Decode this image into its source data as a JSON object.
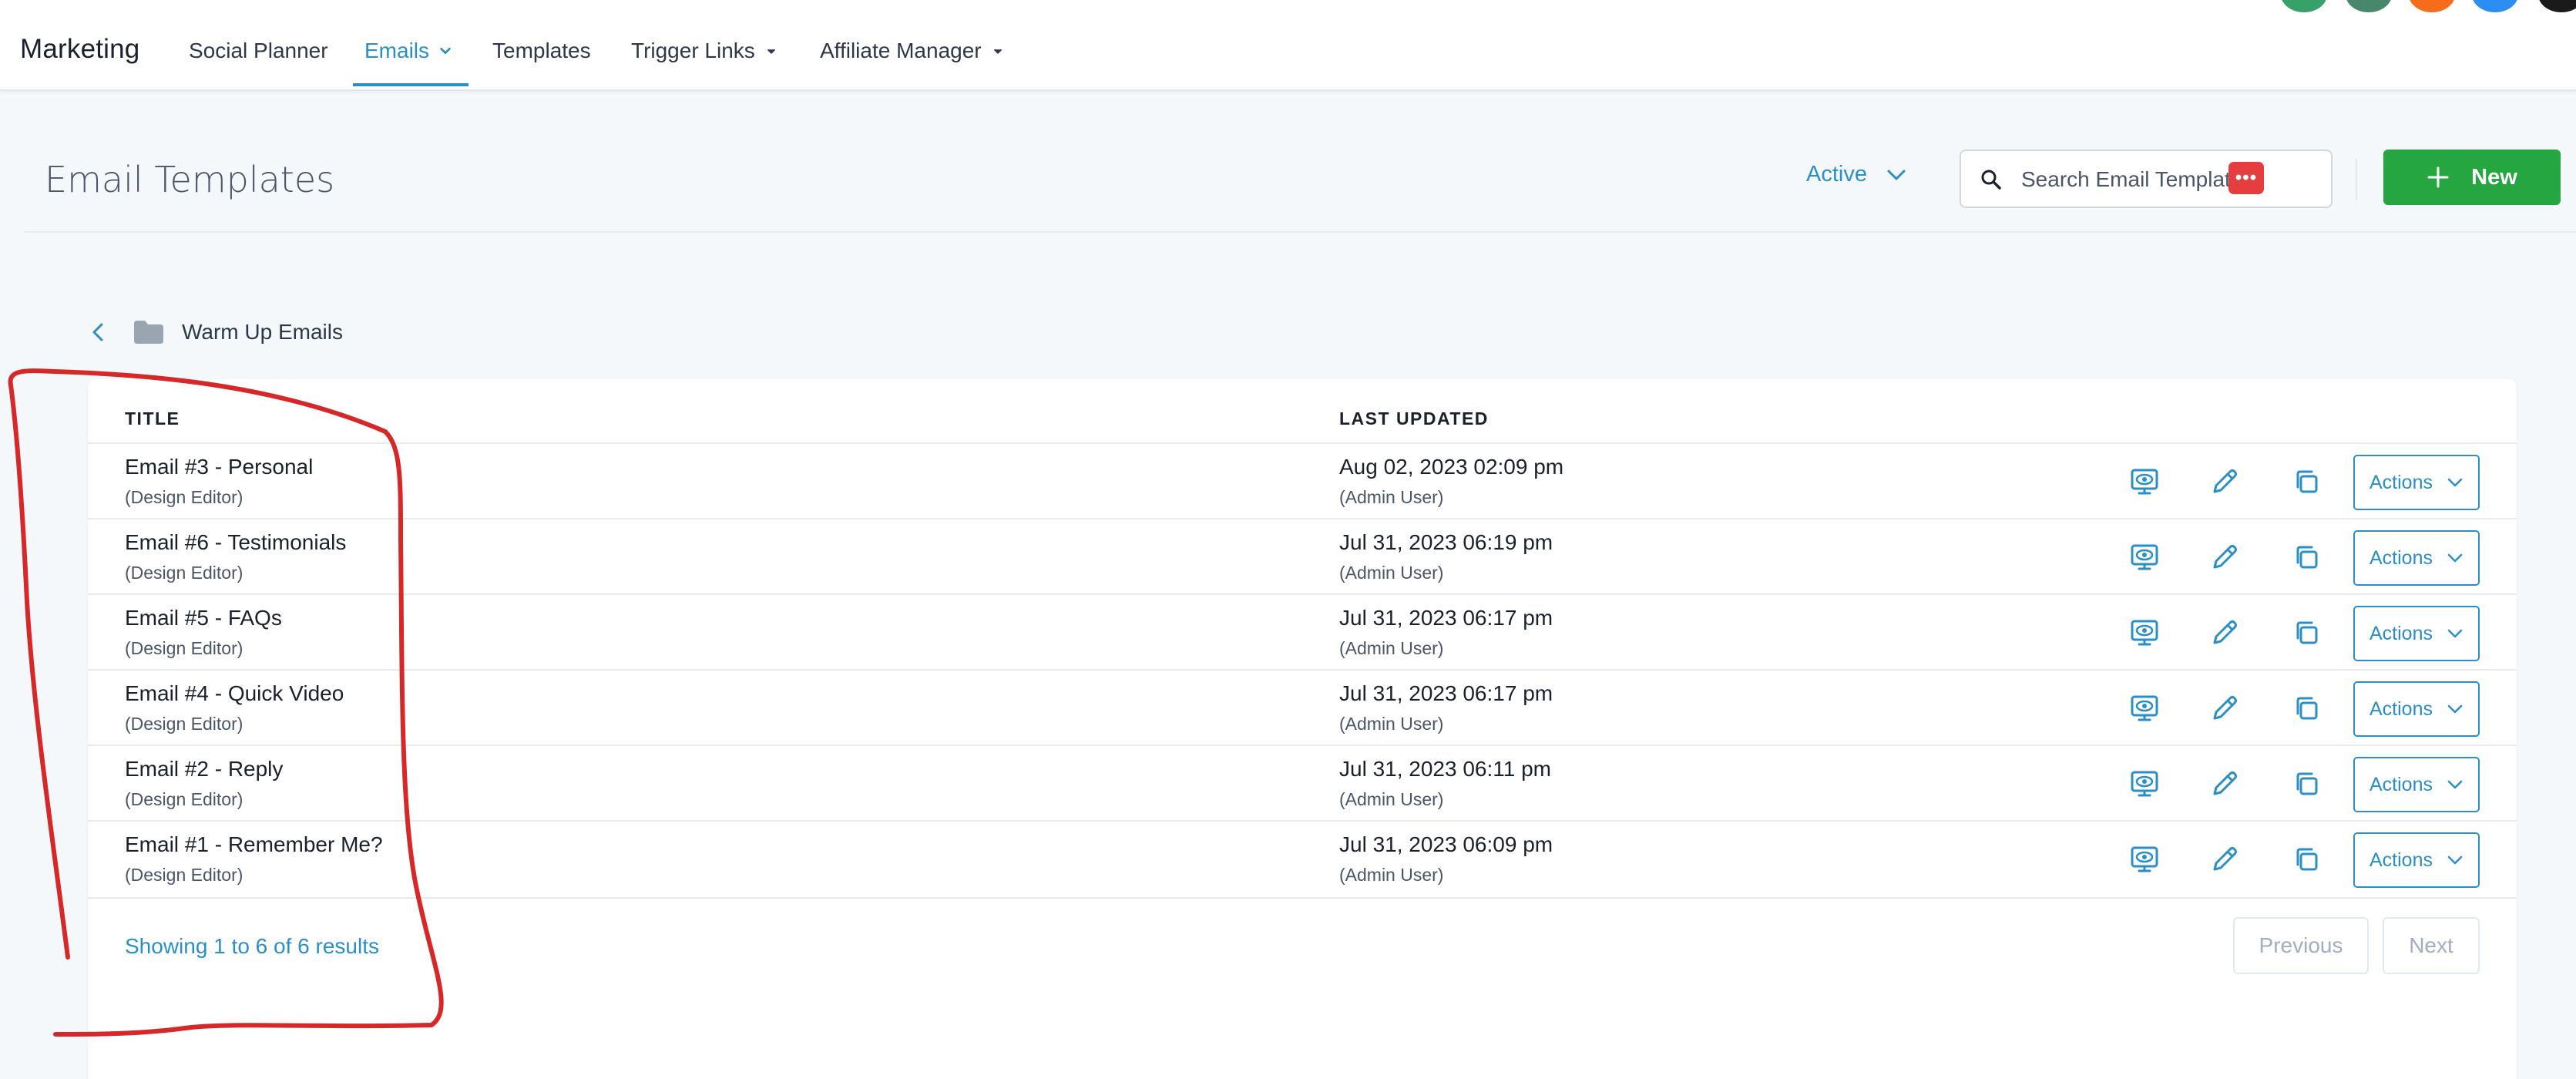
{
  "nav": {
    "brand": "Marketing",
    "items": [
      {
        "label": "Social Planner",
        "active": false,
        "dropdown": false
      },
      {
        "label": "Emails",
        "active": true,
        "dropdown": true
      },
      {
        "label": "Templates",
        "active": false,
        "dropdown": false
      },
      {
        "label": "Trigger Links",
        "active": false,
        "dropdown": true
      },
      {
        "label": "Affiliate Manager",
        "active": false,
        "dropdown": true
      }
    ],
    "avatar_colors": [
      "#38a169",
      "#48876b",
      "#f56c1a",
      "#2b8ef0",
      "#1a1a1a"
    ]
  },
  "header": {
    "title": "Email Templates",
    "status_filter": "Active",
    "search_placeholder": "Search Email Templates",
    "extension_badge": "•••",
    "new_button": "New"
  },
  "folder": {
    "name": "Warm Up Emails"
  },
  "table": {
    "columns": {
      "title": "TITLE",
      "last_updated": "LAST UPDATED"
    },
    "rows": [
      {
        "title": "Email #3 - Personal",
        "editor": "(Design Editor)",
        "date": "Aug 02, 2023 02:09 pm",
        "author": "(Admin User)"
      },
      {
        "title": "Email #6 - Testimonials",
        "editor": "(Design Editor)",
        "date": "Jul 31, 2023 06:19 pm",
        "author": "(Admin User)"
      },
      {
        "title": "Email #5 - FAQs",
        "editor": "(Design Editor)",
        "date": "Jul 31, 2023 06:17 pm",
        "author": "(Admin User)"
      },
      {
        "title": "Email #4 - Quick Video",
        "editor": "(Design Editor)",
        "date": "Jul 31, 2023 06:17 pm",
        "author": "(Admin User)"
      },
      {
        "title": "Email #2 - Reply",
        "editor": "(Design Editor)",
        "date": "Jul 31, 2023 06:11 pm",
        "author": "(Admin User)"
      },
      {
        "title": "Email #1 - Remember Me?",
        "editor": "(Design Editor)",
        "date": "Jul 31, 2023 06:09 pm",
        "author": "(Admin User)"
      }
    ],
    "actions_label": "Actions",
    "row_icons": [
      "preview-icon",
      "edit-pencil-icon",
      "duplicate-icon"
    ]
  },
  "pagination": {
    "summary": "Showing 1 to 6 of 6 results",
    "previous": "Previous",
    "next": "Next"
  },
  "colors": {
    "accent": "#2b8fc7",
    "new_button": "#26a641",
    "annotation_stroke": "#d62828"
  }
}
